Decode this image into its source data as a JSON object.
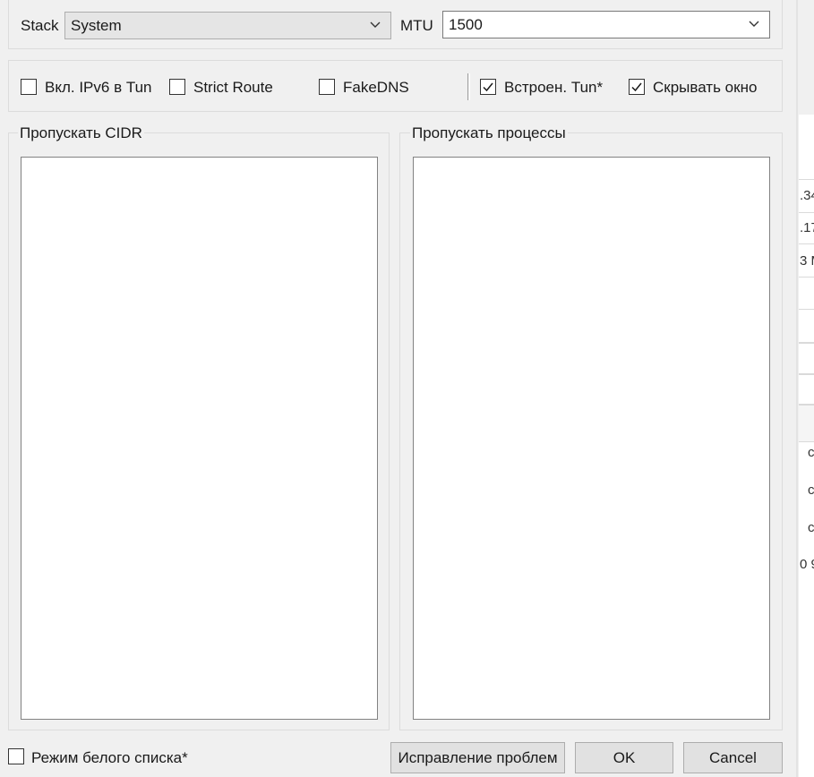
{
  "tun_settings": {
    "stack_label": "Stack",
    "stack_value": "System",
    "mtu_label": "MTU",
    "mtu_value": "1500",
    "options": {
      "ipv6_label": "Вкл. IPv6 в Tun",
      "ipv6_checked": false,
      "strict_route_label": "Strict Route",
      "strict_route_checked": false,
      "fakedns_label": "FakeDNS",
      "fakedns_checked": false,
      "builtin_tun_label": "Встроен. Tun*",
      "builtin_tun_checked": true,
      "hide_window_label": "Скрывать окно",
      "hide_window_checked": true
    },
    "bypass_cidr_label": "Пропускать CIDR",
    "bypass_cidr_value": "",
    "bypass_process_label": "Пропускать процессы",
    "bypass_process_value": "",
    "whitelist_label": "Режим белого списка*",
    "whitelist_checked": false,
    "troubleshoot_button": "Исправление проблем",
    "ok_button": "OK",
    "cancel_button": "Cancel"
  },
  "background_window": {
    "fragments": [
      ".34",
      ".17",
      "3 M",
      "c",
      "c",
      "c",
      "0 9"
    ]
  }
}
